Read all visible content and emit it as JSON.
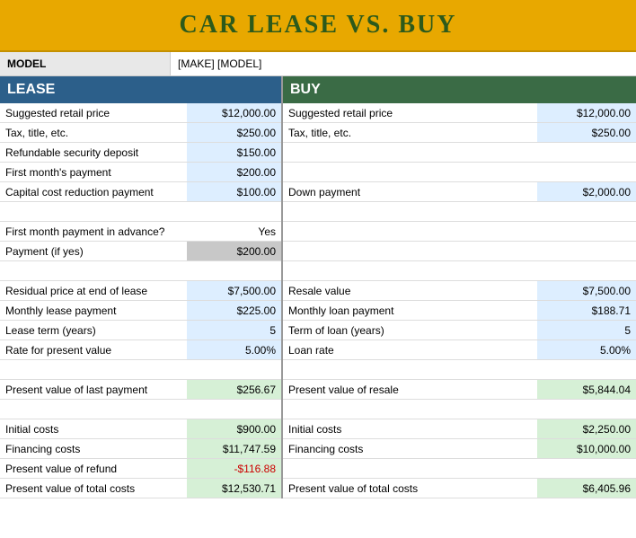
{
  "title": "CAR LEASE VS. BUY",
  "model": {
    "label": "MODEL",
    "value": "[MAKE] [MODEL]"
  },
  "lease": {
    "header": "LEASE",
    "rows": [
      {
        "label": "Suggested retail price",
        "value": "$12,000.00",
        "labelBg": "bg-white",
        "valueBg": "bg-light-blue"
      },
      {
        "label": "Tax, title, etc.",
        "value": "$250.00",
        "labelBg": "bg-white",
        "valueBg": "bg-light-blue"
      },
      {
        "label": "Refundable security deposit",
        "value": "$150.00",
        "labelBg": "bg-white",
        "valueBg": "bg-light-blue"
      },
      {
        "label": "First month's payment",
        "value": "$200.00",
        "labelBg": "bg-white",
        "valueBg": "bg-light-blue"
      },
      {
        "label": "Capital cost reduction payment",
        "value": "$100.00",
        "labelBg": "bg-white",
        "valueBg": "bg-light-blue"
      },
      {
        "label": "spacer",
        "value": "",
        "labelBg": "bg-white",
        "valueBg": "bg-white"
      },
      {
        "label": "First month payment in advance?",
        "value": "Yes",
        "labelBg": "bg-white",
        "valueBg": "bg-white"
      },
      {
        "label": "Payment (if yes)",
        "value": "$200.00",
        "labelBg": "bg-white",
        "valueBg": "bg-gray"
      },
      {
        "label": "spacer",
        "value": "",
        "labelBg": "bg-white",
        "valueBg": "bg-white"
      },
      {
        "label": "Residual price at end of lease",
        "value": "$7,500.00",
        "labelBg": "bg-white",
        "valueBg": "bg-light-blue"
      },
      {
        "label": "Monthly lease payment",
        "value": "$225.00",
        "labelBg": "bg-white",
        "valueBg": "bg-light-blue"
      },
      {
        "label": "Lease term (years)",
        "value": "5",
        "labelBg": "bg-white",
        "valueBg": "bg-light-blue"
      },
      {
        "label": "Rate for present value",
        "value": "5.00%",
        "labelBg": "bg-white",
        "valueBg": "bg-light-blue"
      },
      {
        "label": "spacer",
        "value": "",
        "labelBg": "bg-white",
        "valueBg": "bg-white"
      },
      {
        "label": "Present value of last payment",
        "value": "$256.67",
        "labelBg": "bg-white",
        "valueBg": "bg-light-green"
      },
      {
        "label": "spacer",
        "value": "",
        "labelBg": "bg-white",
        "valueBg": "bg-white"
      },
      {
        "label": "Initial costs",
        "value": "$900.00",
        "labelBg": "bg-white",
        "valueBg": "bg-light-green"
      },
      {
        "label": "Financing costs",
        "value": "$11,747.59",
        "labelBg": "bg-white",
        "valueBg": "bg-light-green"
      },
      {
        "label": "Present value of refund",
        "value": "-$116.88",
        "labelBg": "bg-white",
        "valueBg": "bg-light-green"
      },
      {
        "label": "Present value of total costs",
        "value": "$12,530.71",
        "labelBg": "bg-white",
        "valueBg": "bg-light-green"
      }
    ]
  },
  "buy": {
    "header": "BUY",
    "rows": [
      {
        "label": "Suggested retail price",
        "value": "$12,000.00",
        "labelBg": "bg-white",
        "valueBg": "bg-light-blue"
      },
      {
        "label": "Tax, title, etc.",
        "value": "$250.00",
        "labelBg": "bg-white",
        "valueBg": "bg-light-blue"
      },
      {
        "label": "",
        "value": "",
        "labelBg": "bg-white",
        "valueBg": "bg-white"
      },
      {
        "label": "",
        "value": "",
        "labelBg": "bg-white",
        "valueBg": "bg-white"
      },
      {
        "label": "Down payment",
        "value": "$2,000.00",
        "labelBg": "bg-white",
        "valueBg": "bg-light-blue"
      },
      {
        "label": "",
        "value": "",
        "labelBg": "bg-white",
        "valueBg": "bg-white"
      },
      {
        "label": "",
        "value": "",
        "labelBg": "bg-white",
        "valueBg": "bg-white"
      },
      {
        "label": "",
        "value": "",
        "labelBg": "bg-white",
        "valueBg": "bg-white"
      },
      {
        "label": "",
        "value": "",
        "labelBg": "bg-white",
        "valueBg": "bg-white"
      },
      {
        "label": "Resale value",
        "value": "$7,500.00",
        "labelBg": "bg-white",
        "valueBg": "bg-light-blue"
      },
      {
        "label": "Monthly loan payment",
        "value": "$188.71",
        "labelBg": "bg-white",
        "valueBg": "bg-light-blue"
      },
      {
        "label": "Term of loan (years)",
        "value": "5",
        "labelBg": "bg-white",
        "valueBg": "bg-light-blue"
      },
      {
        "label": "Loan rate",
        "value": "5.00%",
        "labelBg": "bg-white",
        "valueBg": "bg-light-blue"
      },
      {
        "label": "",
        "value": "",
        "labelBg": "bg-white",
        "valueBg": "bg-white"
      },
      {
        "label": "Present value of resale",
        "value": "$5,844.04",
        "labelBg": "bg-white",
        "valueBg": "bg-light-green"
      },
      {
        "label": "",
        "value": "",
        "labelBg": "bg-white",
        "valueBg": "bg-white"
      },
      {
        "label": "Initial costs",
        "value": "$2,250.00",
        "labelBg": "bg-white",
        "valueBg": "bg-light-green"
      },
      {
        "label": "Financing costs",
        "value": "$10,000.00",
        "labelBg": "bg-white",
        "valueBg": "bg-light-green"
      },
      {
        "label": "",
        "value": "",
        "labelBg": "bg-white",
        "valueBg": "bg-white"
      },
      {
        "label": "Present value of total costs",
        "value": "$6,405.96",
        "labelBg": "bg-white",
        "valueBg": "bg-light-green"
      }
    ]
  }
}
